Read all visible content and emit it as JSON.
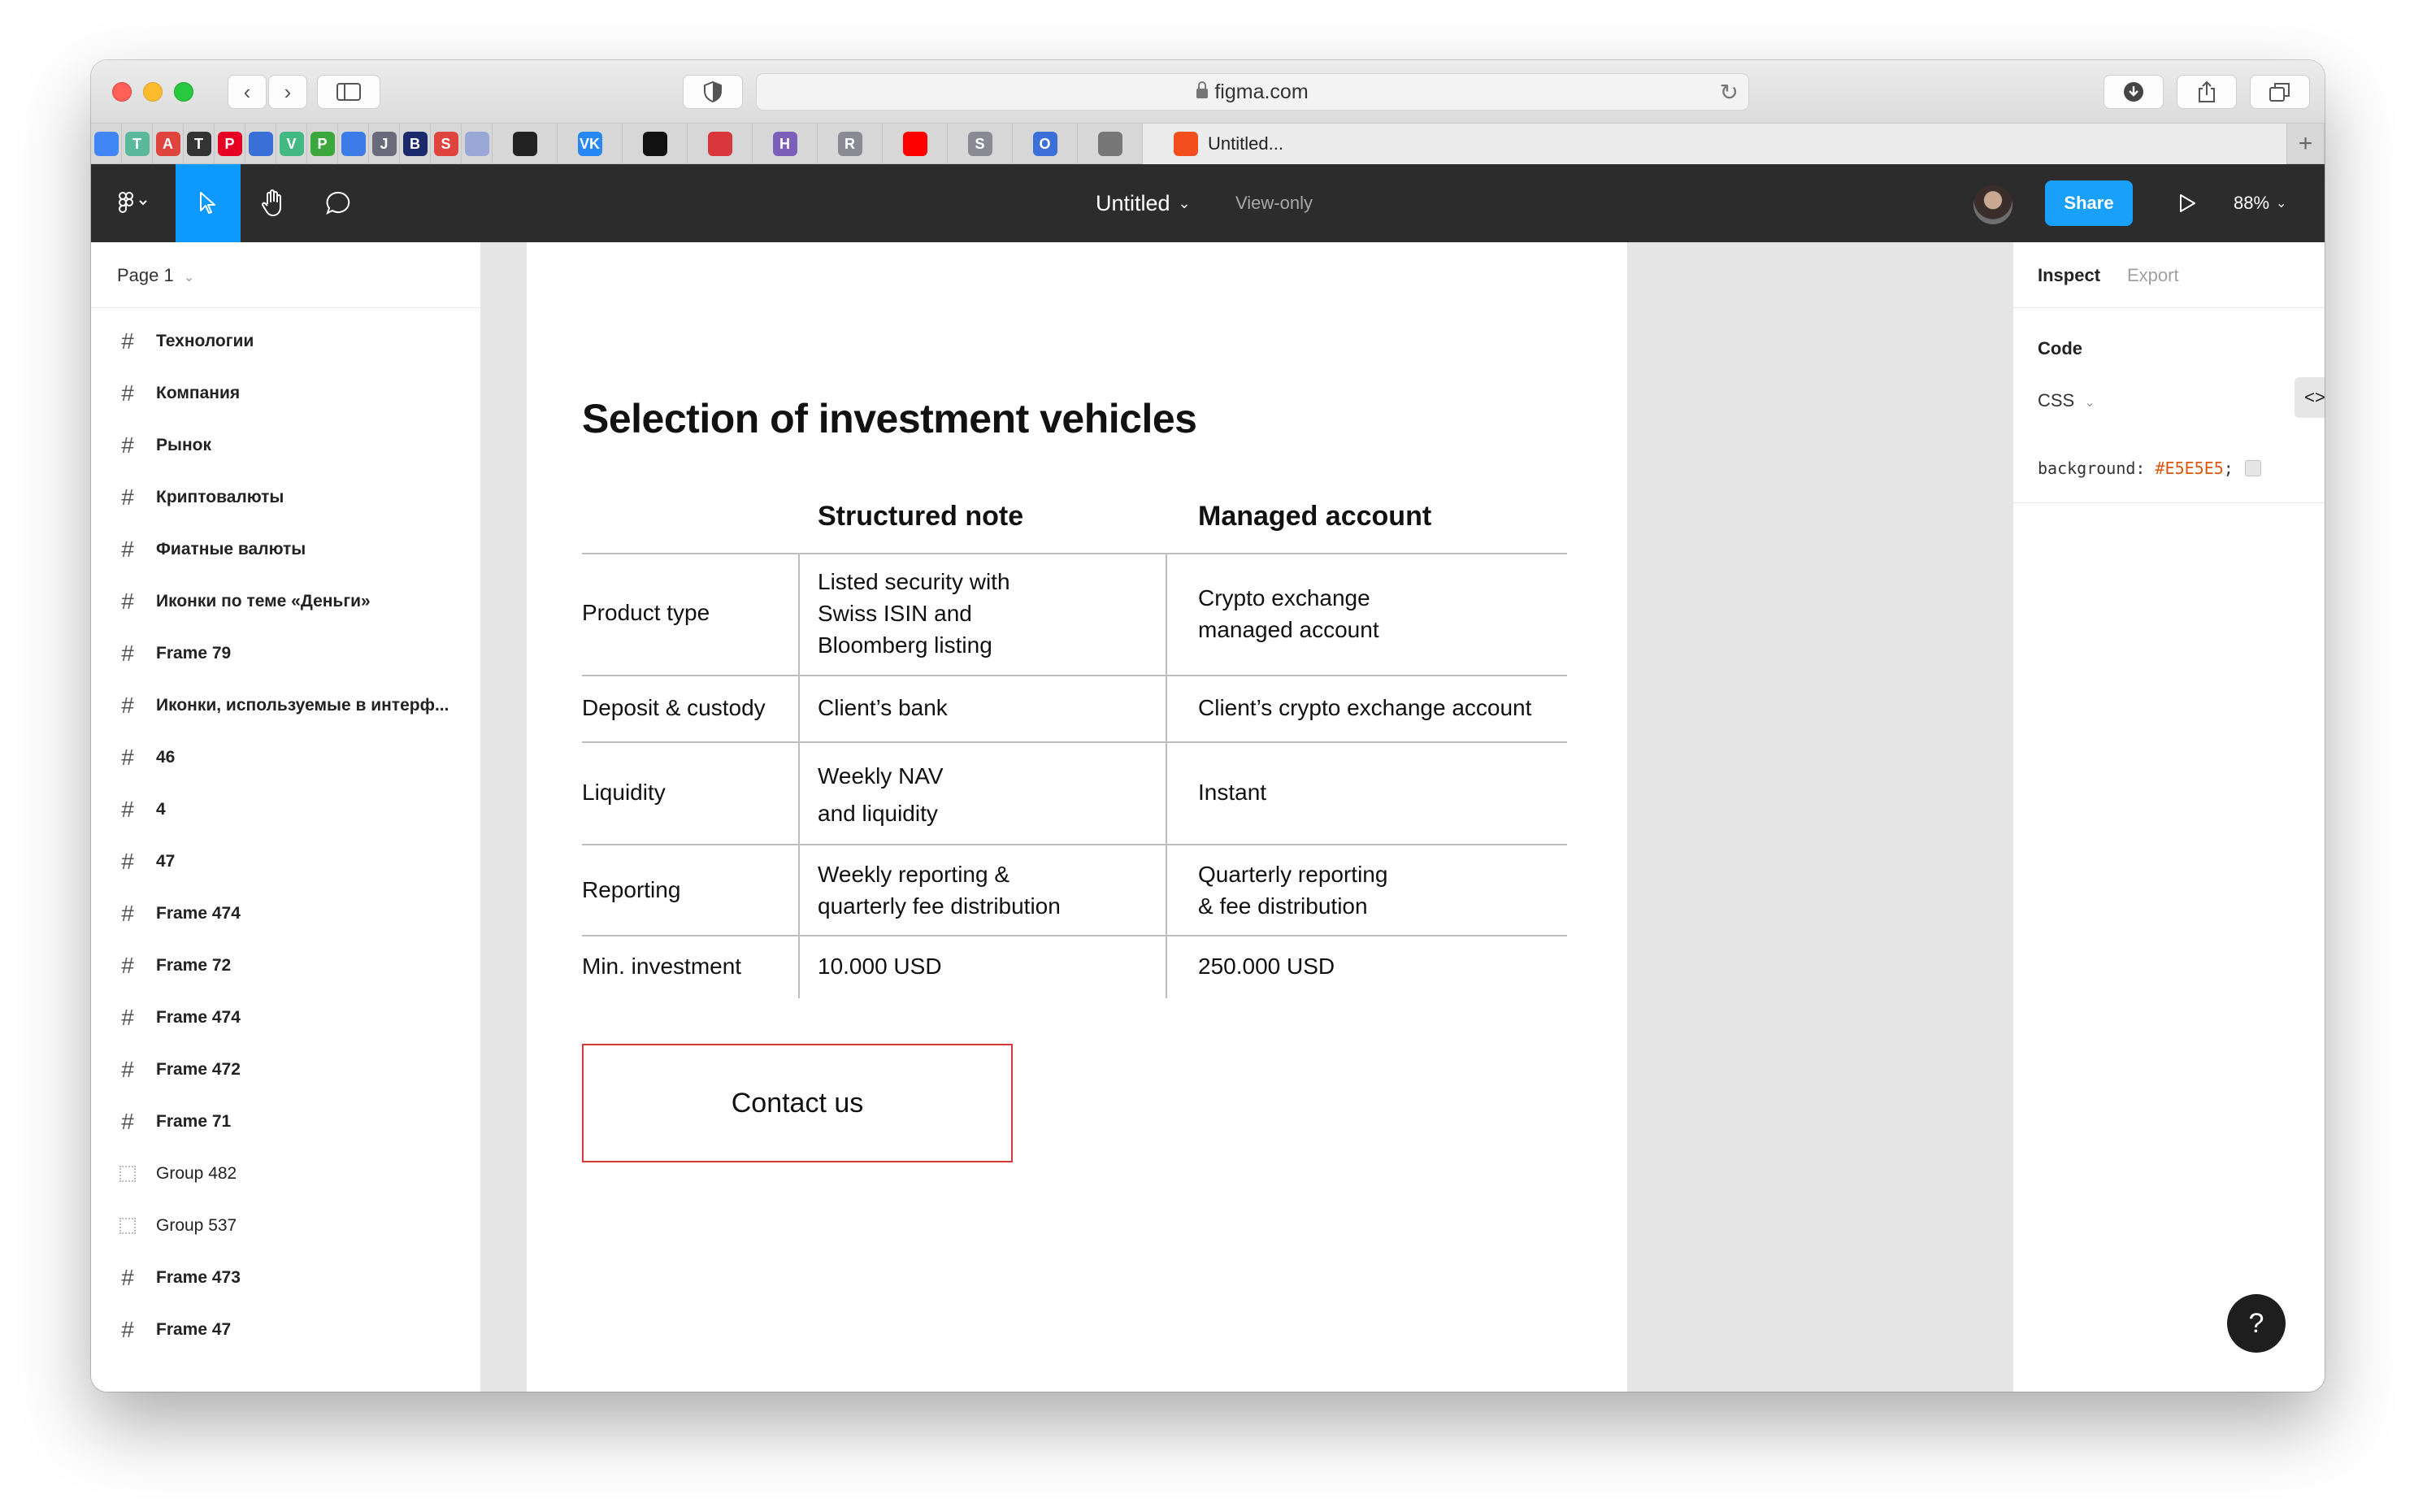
{
  "browser": {
    "url": "figma.com",
    "active_tab_title": "Untitled...",
    "new_tab_symbol": "+",
    "bookmarks": [
      {
        "icon": "chrome-icon",
        "letter": "",
        "color": "#4285f4"
      },
      {
        "icon": "t-green-icon",
        "letter": "T",
        "color": "#5bb89b"
      },
      {
        "icon": "acrobat-icon",
        "letter": "A",
        "color": "#e0443e"
      },
      {
        "icon": "typora-icon",
        "letter": "T",
        "color": "#333333"
      },
      {
        "icon": "pinterest-icon",
        "letter": "P",
        "color": "#e60023"
      },
      {
        "icon": "reddit-bot-icon",
        "letter": "",
        "color": "#3b6fd8"
      },
      {
        "icon": "vue-icon",
        "letter": "V",
        "color": "#42b883"
      },
      {
        "icon": "p-green-icon",
        "letter": "P",
        "color": "#3ca73c"
      },
      {
        "icon": "blue-square-icon",
        "letter": "",
        "color": "#3d7be6"
      },
      {
        "icon": "j-icon",
        "letter": "J",
        "color": "#6a6a7a"
      },
      {
        "icon": "b-icon",
        "letter": "B",
        "color": "#1b2a6b"
      },
      {
        "icon": "s-red-icon",
        "letter": "S",
        "color": "#e0443e"
      },
      {
        "icon": "play-circle-icon",
        "letter": "",
        "color": "#9aa8d8"
      },
      {
        "icon": "instagram-icon",
        "letter": "",
        "color": "#222222"
      },
      {
        "icon": "vk-icon",
        "letter": "VK",
        "color": "#2787f5"
      },
      {
        "icon": "github-icon",
        "letter": "",
        "color": "#111111"
      },
      {
        "icon": "cluster-icon",
        "letter": "",
        "color": "#d8383d"
      },
      {
        "icon": "h-icon",
        "letter": "H",
        "color": "#7b5fb8"
      },
      {
        "icon": "r-icon",
        "letter": "R",
        "color": "#8a8a94"
      },
      {
        "icon": "youtube-icon",
        "letter": "",
        "color": "#ff0000"
      },
      {
        "icon": "s-grey-icon",
        "letter": "S",
        "color": "#8a8a94"
      },
      {
        "icon": "o-icon",
        "letter": "O",
        "color": "#3d6fd8"
      },
      {
        "icon": "compass-icon",
        "letter": "",
        "color": "#777777"
      }
    ]
  },
  "figma": {
    "doc_title": "Untitled",
    "doc_status": "View-only",
    "share_label": "Share",
    "zoom": "88%",
    "page_label": "Page 1",
    "accent_color": "#0d99ff",
    "layers": [
      {
        "name": "Технологии",
        "type": "frame"
      },
      {
        "name": "Компания",
        "type": "frame"
      },
      {
        "name": "Рынок",
        "type": "frame"
      },
      {
        "name": "Криптовалюты",
        "type": "frame"
      },
      {
        "name": "Фиатные валюты",
        "type": "frame"
      },
      {
        "name": "Иконки по теме «Деньги»",
        "type": "frame"
      },
      {
        "name": "Frame 79",
        "type": "frame"
      },
      {
        "name": "Иконки, используемые в интерф...",
        "type": "frame"
      },
      {
        "name": "46",
        "type": "frame"
      },
      {
        "name": "4",
        "type": "frame"
      },
      {
        "name": "47",
        "type": "frame"
      },
      {
        "name": "Frame 474",
        "type": "frame"
      },
      {
        "name": "Frame 72",
        "type": "frame"
      },
      {
        "name": "Frame 474",
        "type": "frame"
      },
      {
        "name": "Frame 472",
        "type": "frame"
      },
      {
        "name": "Frame 71",
        "type": "frame"
      },
      {
        "name": "Group 482",
        "type": "group"
      },
      {
        "name": "Group 537",
        "type": "group"
      },
      {
        "name": "Frame 473",
        "type": "frame"
      },
      {
        "name": "Frame 47",
        "type": "frame"
      }
    ]
  },
  "design": {
    "title": "Selection of investment vehicles",
    "columns": [
      "Structured note",
      "Managed account"
    ],
    "rows": [
      {
        "label": "Product type",
        "note": "Listed security with\nSwiss ISIN and\nBloomberg listing",
        "account": "Crypto exchange\nmanaged account"
      },
      {
        "label": "Deposit & custody",
        "note": "Client’s bank",
        "account": "Client’s crypto exchange account"
      },
      {
        "label": "Liquidity",
        "note": "Weekly NAV\nand liquidity",
        "account": "Instant"
      },
      {
        "label": "Reporting",
        "note": "Weekly reporting &\nquarterly fee distribution",
        "account": "Quarterly reporting\n& fee distribution"
      },
      {
        "label": "Min. investment",
        "note": "10.000 USD",
        "account": "250.000 USD"
      }
    ],
    "cta_label": "Contact us",
    "cta_border_color": "#d83a3a"
  },
  "inspect": {
    "tabs": [
      "Inspect",
      "Export"
    ],
    "code_title": "Code",
    "language": "CSS",
    "code_property": "background: ",
    "code_value": "#E5E5E5",
    "code_suffix": ";",
    "swatch_color": "#e5e5e5",
    "help_label": "?"
  }
}
